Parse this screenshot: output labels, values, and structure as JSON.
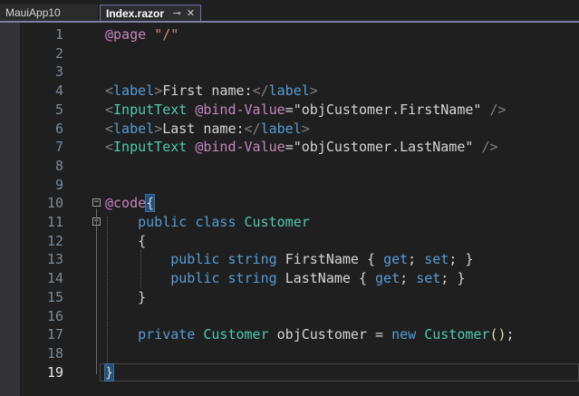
{
  "tabs": [
    {
      "label": "MauiApp10",
      "active": false
    },
    {
      "label": "Index.razor",
      "active": true,
      "pin_icon": "pin-icon",
      "close_icon": "close-icon"
    }
  ],
  "colors": {
    "background": "#1f1f1f",
    "accent": "#7e7ea0",
    "keyword": "#569cd6",
    "type": "#4ec9b0",
    "string": "#ce9178",
    "directive": "#c586c0"
  },
  "current_line": 19,
  "lines": [
    {
      "number": "1",
      "tokens": [
        {
          "t": "@page",
          "c": "dir"
        },
        {
          "t": " ",
          "c": "id"
        },
        {
          "t": "\"/\"",
          "c": "str"
        }
      ]
    },
    {
      "number": "2",
      "tokens": []
    },
    {
      "number": "3",
      "tokens": []
    },
    {
      "number": "4",
      "tokens": [
        {
          "t": "<",
          "c": "tag"
        },
        {
          "t": "label",
          "c": "tagn"
        },
        {
          "t": ">",
          "c": "tag"
        },
        {
          "t": "First name:",
          "c": "id"
        },
        {
          "t": "</",
          "c": "tag"
        },
        {
          "t": "label",
          "c": "tagn"
        },
        {
          "t": ">",
          "c": "tag"
        }
      ]
    },
    {
      "number": "5",
      "tokens": [
        {
          "t": "<",
          "c": "tag"
        },
        {
          "t": "InputText",
          "c": "comp"
        },
        {
          "t": " ",
          "c": "id"
        },
        {
          "t": "@bind-Value",
          "c": "attr"
        },
        {
          "t": "=",
          "c": "id"
        },
        {
          "t": "\"",
          "c": "id"
        },
        {
          "t": "objCustomer.FirstName",
          "c": "id"
        },
        {
          "t": "\"",
          "c": "id"
        },
        {
          "t": " ",
          "c": "id"
        },
        {
          "t": "/>",
          "c": "tag"
        }
      ]
    },
    {
      "number": "6",
      "tokens": [
        {
          "t": "<",
          "c": "tag"
        },
        {
          "t": "label",
          "c": "tagn"
        },
        {
          "t": ">",
          "c": "tag"
        },
        {
          "t": "Last name:",
          "c": "id"
        },
        {
          "t": "</",
          "c": "tag"
        },
        {
          "t": "label",
          "c": "tagn"
        },
        {
          "t": ">",
          "c": "tag"
        }
      ]
    },
    {
      "number": "7",
      "tokens": [
        {
          "t": "<",
          "c": "tag"
        },
        {
          "t": "InputText",
          "c": "comp"
        },
        {
          "t": " ",
          "c": "id"
        },
        {
          "t": "@bind-Value",
          "c": "attr"
        },
        {
          "t": "=",
          "c": "id"
        },
        {
          "t": "\"",
          "c": "id"
        },
        {
          "t": "objCustomer.LastName",
          "c": "id"
        },
        {
          "t": "\"",
          "c": "id"
        },
        {
          "t": " ",
          "c": "id"
        },
        {
          "t": "/>",
          "c": "tag"
        }
      ]
    },
    {
      "number": "8",
      "tokens": []
    },
    {
      "number": "9",
      "tokens": []
    },
    {
      "number": "10",
      "tokens": [
        {
          "t": "@code",
          "c": "dir"
        },
        {
          "t": "{",
          "c": "punc",
          "hl": true
        }
      ],
      "fold": "−"
    },
    {
      "number": "11",
      "tokens": [
        {
          "t": "    ",
          "c": "id"
        },
        {
          "t": "public",
          "c": "kw"
        },
        {
          "t": " ",
          "c": "id"
        },
        {
          "t": "class",
          "c": "kw"
        },
        {
          "t": " ",
          "c": "id"
        },
        {
          "t": "Customer",
          "c": "type"
        }
      ],
      "fold": "−"
    },
    {
      "number": "12",
      "tokens": [
        {
          "t": "    ",
          "c": "id"
        },
        {
          "t": "{",
          "c": "punc"
        }
      ]
    },
    {
      "number": "13",
      "tokens": [
        {
          "t": "        ",
          "c": "id"
        },
        {
          "t": "public",
          "c": "kw"
        },
        {
          "t": " ",
          "c": "id"
        },
        {
          "t": "string",
          "c": "kw"
        },
        {
          "t": " ",
          "c": "id"
        },
        {
          "t": "FirstName",
          "c": "id"
        },
        {
          "t": " { ",
          "c": "punc"
        },
        {
          "t": "get",
          "c": "kw"
        },
        {
          "t": "; ",
          "c": "punc"
        },
        {
          "t": "set",
          "c": "kw"
        },
        {
          "t": "; }",
          "c": "punc"
        }
      ]
    },
    {
      "number": "14",
      "tokens": [
        {
          "t": "        ",
          "c": "id"
        },
        {
          "t": "public",
          "c": "kw"
        },
        {
          "t": " ",
          "c": "id"
        },
        {
          "t": "string",
          "c": "kw"
        },
        {
          "t": " ",
          "c": "id"
        },
        {
          "t": "LastName",
          "c": "id"
        },
        {
          "t": " { ",
          "c": "punc"
        },
        {
          "t": "get",
          "c": "kw"
        },
        {
          "t": "; ",
          "c": "punc"
        },
        {
          "t": "set",
          "c": "kw"
        },
        {
          "t": "; }",
          "c": "punc"
        }
      ]
    },
    {
      "number": "15",
      "tokens": [
        {
          "t": "    ",
          "c": "id"
        },
        {
          "t": "}",
          "c": "punc"
        }
      ]
    },
    {
      "number": "16",
      "tokens": []
    },
    {
      "number": "17",
      "tokens": [
        {
          "t": "    ",
          "c": "id"
        },
        {
          "t": "private",
          "c": "kw"
        },
        {
          "t": " ",
          "c": "id"
        },
        {
          "t": "Customer",
          "c": "type"
        },
        {
          "t": " ",
          "c": "id"
        },
        {
          "t": "objCustomer",
          "c": "id"
        },
        {
          "t": " = ",
          "c": "punc"
        },
        {
          "t": "new",
          "c": "kw"
        },
        {
          "t": " ",
          "c": "id"
        },
        {
          "t": "Customer",
          "c": "type"
        },
        {
          "t": "(",
          "c": "meth"
        },
        {
          "t": ")",
          "c": "meth"
        },
        {
          "t": ";",
          "c": "punc"
        }
      ]
    },
    {
      "number": "18",
      "tokens": []
    },
    {
      "number": "19",
      "tokens": [
        {
          "t": "}",
          "c": "punc",
          "hl": true
        }
      ]
    }
  ]
}
